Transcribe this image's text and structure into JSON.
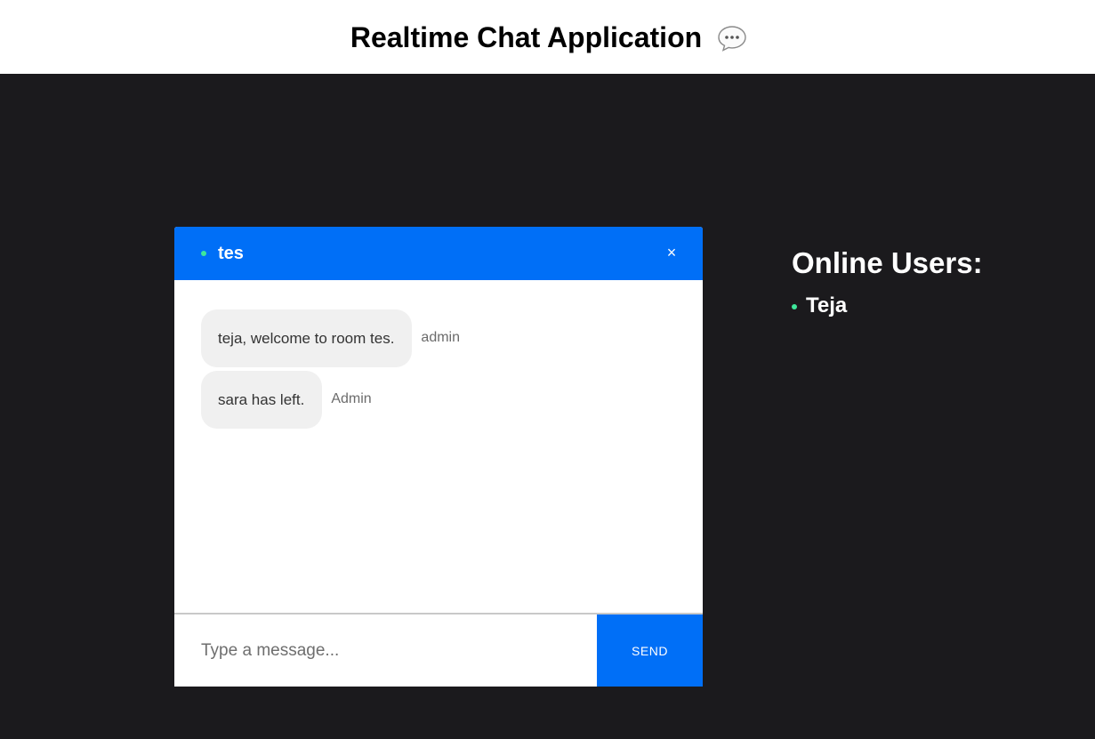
{
  "header": {
    "title": "Realtime Chat Application",
    "icon": "speech-bubble-icon"
  },
  "chat": {
    "room_name": "tes",
    "close_label": "×",
    "messages": [
      {
        "text": "teja, welcome to room tes.",
        "sender": "admin"
      },
      {
        "text": "sara has left.",
        "sender": "Admin"
      }
    ],
    "input": {
      "placeholder": "Type a message...",
      "value": ""
    },
    "send_label": "SEND"
  },
  "online": {
    "title": "Online Users:",
    "users": [
      {
        "name": "Teja"
      }
    ]
  },
  "colors": {
    "accent": "#006ff7",
    "online_dot": "#3ee89b",
    "background": "#1b1a1d",
    "bubble": "#f0f0f0"
  }
}
